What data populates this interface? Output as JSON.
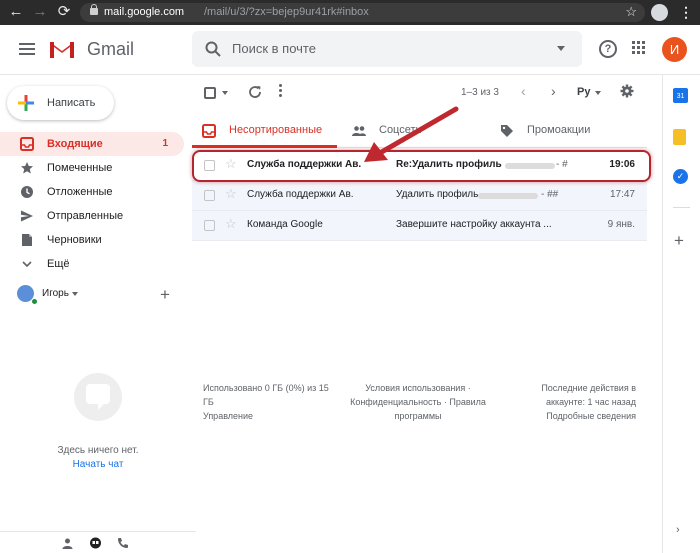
{
  "browser": {
    "back": "←",
    "forward": "→",
    "reload": "⟳",
    "url_host": "mail.google.com",
    "url_path": "/mail/u/3/?zx=bejep9ur41rk#inbox",
    "star": "☆",
    "menu": "⋮"
  },
  "header": {
    "app_name": "Gmail",
    "search_placeholder": "Поиск в почте",
    "help": "?",
    "account_initial": "И"
  },
  "sidebar": {
    "compose_label": "Написать",
    "items": [
      {
        "label": "Входящие",
        "count": "1",
        "icon": "inbox-icon"
      },
      {
        "label": "Помеченные",
        "count": "",
        "icon": "star-icon"
      },
      {
        "label": "Отложенные",
        "count": "",
        "icon": "clock-icon"
      },
      {
        "label": "Отправленные",
        "count": "",
        "icon": "send-icon"
      },
      {
        "label": "Черновики",
        "count": "",
        "icon": "draft-icon"
      },
      {
        "label": "Ещё",
        "count": "",
        "icon": "chevron-down-icon"
      }
    ],
    "user_name": "Игорь",
    "add": "+",
    "empty_chat_text": "Здесь ничего нет.",
    "start_chat": "Начать чат"
  },
  "toolbar": {
    "page_range": "1–3 из 3",
    "prev": "‹",
    "next": "›",
    "input_language": "Ру"
  },
  "tabs": [
    {
      "label": "Несортированные",
      "icon": "inbox-icon",
      "active": true
    },
    {
      "label": "Соцсети",
      "icon": "people-icon",
      "active": false
    },
    {
      "label": "Промоакции",
      "icon": "tag-icon",
      "active": false
    }
  ],
  "emails": [
    {
      "sender": "Служба поддержки Ав.",
      "subject": "Re:Удалить профиль",
      "snippet": "- #",
      "time": "19:06",
      "unread": true
    },
    {
      "sender": "Служба поддержки Ав.",
      "subject": "Удалить профиль",
      "snippet": "- ##",
      "time": "17:47",
      "unread": false
    },
    {
      "sender": "Команда Google",
      "subject": "Завершите настройку аккаунта ...",
      "snippet": "",
      "time": "9 янв.",
      "unread": false
    }
  ],
  "footer": {
    "storage_line1": "Использовано 0 ГБ (0%) из 15",
    "storage_line2": "ГБ",
    "storage_manage": "Управление",
    "terms": "Условия использования ·",
    "privacy": "Конфиденциальность · Правила",
    "programs": "программы",
    "activity_line1": "Последние действия в",
    "activity_line2": "аккаунте: 1 час назад",
    "activity_details": "Подробные сведения"
  },
  "side_panel": {
    "calendar_day": "31",
    "tasks": "✓",
    "add": "+"
  },
  "colors": {
    "accent_red": "#d93025",
    "highlight_red": "#b3262f",
    "link_blue": "#1a73e8",
    "avatar_orange": "#e8531e"
  }
}
